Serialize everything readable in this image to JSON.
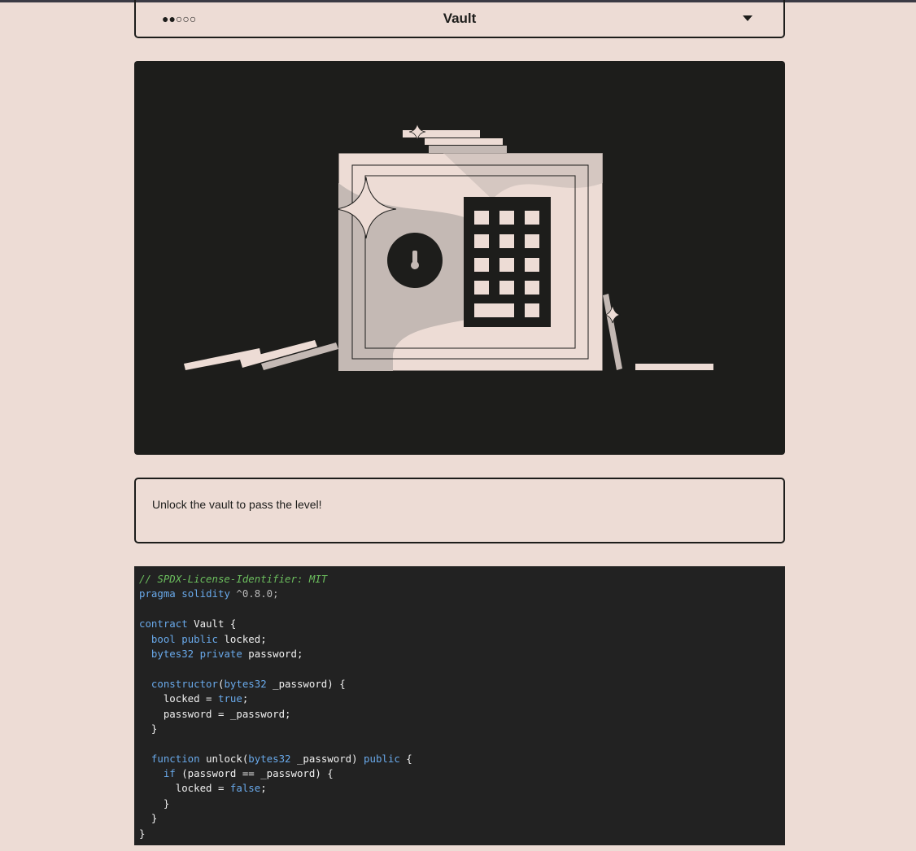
{
  "header": {
    "difficulty": "●●○○○",
    "title": "Vault"
  },
  "description": "Unlock the vault to pass the level!",
  "colors": {
    "background": "#eddcd5",
    "dark": "#1d1d1b",
    "code_bg": "#222222",
    "keyword": "#69a9ea",
    "comment": "#6cbf5e"
  },
  "icons": {
    "dropdown": "caret-down-icon",
    "illustration": "vault-safe-illustration"
  },
  "code": {
    "lines": [
      [
        {
          "t": "// SPDX-License-Identifier: MIT",
          "c": "comment"
        }
      ],
      [
        {
          "t": "pragma",
          "c": "kw"
        },
        {
          "t": " ",
          "c": "plain"
        },
        {
          "t": "solidity",
          "c": "kw"
        },
        {
          "t": " ^0.8.0;",
          "c": "num"
        }
      ],
      [],
      [
        {
          "t": "contract",
          "c": "kw"
        },
        {
          "t": " Vault {",
          "c": "plain"
        }
      ],
      [
        {
          "t": "  ",
          "c": "plain"
        },
        {
          "t": "bool",
          "c": "kw"
        },
        {
          "t": " ",
          "c": "plain"
        },
        {
          "t": "public",
          "c": "kw"
        },
        {
          "t": " locked;",
          "c": "plain"
        }
      ],
      [
        {
          "t": "  ",
          "c": "plain"
        },
        {
          "t": "bytes32",
          "c": "kw"
        },
        {
          "t": " ",
          "c": "plain"
        },
        {
          "t": "private",
          "c": "kw"
        },
        {
          "t": " password;",
          "c": "plain"
        }
      ],
      [],
      [
        {
          "t": "  ",
          "c": "plain"
        },
        {
          "t": "constructor",
          "c": "kw"
        },
        {
          "t": "(",
          "c": "plain"
        },
        {
          "t": "bytes32",
          "c": "kw"
        },
        {
          "t": " _password) {",
          "c": "plain"
        }
      ],
      [
        {
          "t": "    locked = ",
          "c": "plain"
        },
        {
          "t": "true",
          "c": "kw"
        },
        {
          "t": ";",
          "c": "plain"
        }
      ],
      [
        {
          "t": "    password = _password;",
          "c": "plain"
        }
      ],
      [
        {
          "t": "  }",
          "c": "plain"
        }
      ],
      [],
      [
        {
          "t": "  ",
          "c": "plain"
        },
        {
          "t": "function",
          "c": "kw"
        },
        {
          "t": " unlock(",
          "c": "plain"
        },
        {
          "t": "bytes32",
          "c": "kw"
        },
        {
          "t": " _password) ",
          "c": "plain"
        },
        {
          "t": "public",
          "c": "kw"
        },
        {
          "t": " {",
          "c": "plain"
        }
      ],
      [
        {
          "t": "    ",
          "c": "plain"
        },
        {
          "t": "if",
          "c": "kw"
        },
        {
          "t": " (password == _password) {",
          "c": "plain"
        }
      ],
      [
        {
          "t": "      locked = ",
          "c": "plain"
        },
        {
          "t": "false",
          "c": "kw"
        },
        {
          "t": ";",
          "c": "plain"
        }
      ],
      [
        {
          "t": "    }",
          "c": "plain"
        }
      ],
      [
        {
          "t": "  }",
          "c": "plain"
        }
      ],
      [
        {
          "t": "}",
          "c": "plain"
        }
      ]
    ]
  }
}
